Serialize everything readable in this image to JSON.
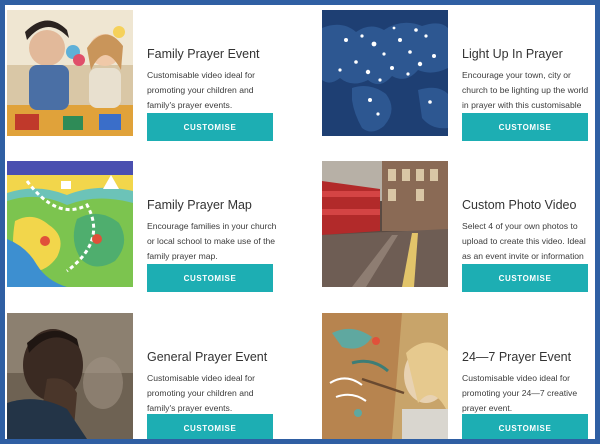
{
  "cards": [
    {
      "title": "Family Prayer Event",
      "description": "Customisable video ideal for promoting your children and family's prayer events.",
      "button_label": "CUSTOMISE",
      "image": "children-painted-hands-photo"
    },
    {
      "title": "Light Up In Prayer",
      "description": "Encourage your town, city or church to be lighting up the world in prayer with this customisable video.",
      "button_label": "CUSTOMISE",
      "image": "world-map-lights-image"
    },
    {
      "title": "Family Prayer Map",
      "description": "Encourage families in your church or local school to make use of the family prayer map.",
      "button_label": "CUSTOMISE",
      "image": "illustrated-prayer-map"
    },
    {
      "title": "Custom Photo Video",
      "description": "Select 4 of your own photos to upload to create this video. Ideal as an event invite or information video.",
      "button_label": "CUSTOMISE",
      "image": "london-street-bus-photo"
    },
    {
      "title": "General Prayer Event",
      "description": "Customisable video ideal for promoting your children and family's prayer events.",
      "button_label": "CUSTOMISE",
      "image": "man-praying-photo"
    },
    {
      "title": "24—7 Prayer Event",
      "description": "Customisable video ideal for promoting your 24—7 creative prayer event.",
      "button_label": "CUSTOMISE",
      "image": "girl-painting-wall-photo"
    }
  ],
  "colors": {
    "frame": "#2f5fa3",
    "button": "#1daeb3",
    "button_text": "#ffffff"
  }
}
